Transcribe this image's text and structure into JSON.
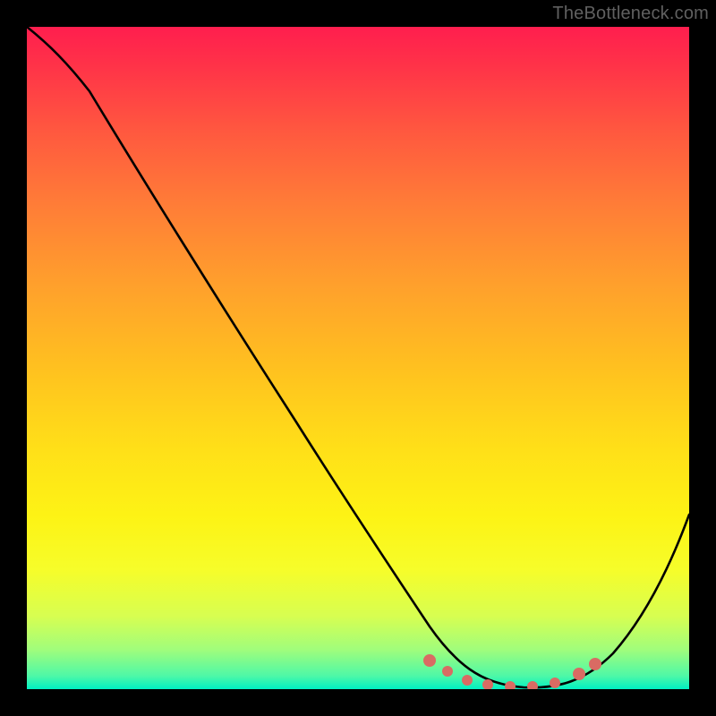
{
  "watermark": "TheBottleneck.com",
  "colors": {
    "background": "#000000",
    "curve": "#000000",
    "dot": "#d96b63",
    "gradient_top": "#ff1e4e",
    "gradient_bottom": "#00f0c3"
  },
  "chart_data": {
    "type": "line",
    "title": "",
    "xlabel": "",
    "ylabel": "",
    "xlim": [
      0,
      100
    ],
    "ylim": [
      0,
      100
    ],
    "note": "No axis ticks or numeric labels are rendered; values below are estimated from shape on a 0–100 scale.",
    "series": [
      {
        "name": "bottleneck-curve",
        "x": [
          0,
          6,
          12,
          20,
          30,
          40,
          50,
          57,
          62,
          67,
          72,
          77,
          82,
          86,
          90,
          95,
          100
        ],
        "values": [
          100,
          96,
          91,
          80,
          65,
          50,
          35,
          24,
          14,
          6,
          2,
          0,
          0,
          2,
          6,
          15,
          27
        ]
      }
    ],
    "markers": [
      {
        "x": 60,
        "y": 3
      },
      {
        "x": 63,
        "y": 2
      },
      {
        "x": 67,
        "y": 1
      },
      {
        "x": 70,
        "y": 0.5
      },
      {
        "x": 74,
        "y": 0.3
      },
      {
        "x": 78,
        "y": 0.3
      },
      {
        "x": 82,
        "y": 0.8
      },
      {
        "x": 85,
        "y": 1.5
      },
      {
        "x": 87,
        "y": 2.2
      }
    ]
  }
}
